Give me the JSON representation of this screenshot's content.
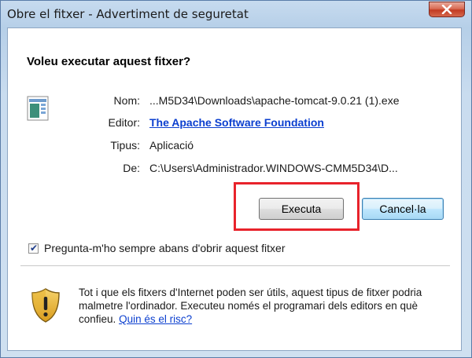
{
  "window": {
    "title": "Obre el fitxer - Advertiment de seguretat"
  },
  "dialog": {
    "heading": "Voleu executar aquest fitxer?",
    "fields": [
      {
        "label": "Nom:",
        "value": "...M5D34\\Downloads\\apache-tomcat-9.0.21 (1).exe"
      },
      {
        "label": "Editor:",
        "value": "The Apache Software Foundation"
      },
      {
        "label": "Tipus:",
        "value": "Aplicació"
      },
      {
        "label": "De:",
        "value": "C:\\Users\\Administrador.WINDOWS-CMM5D34\\D..."
      }
    ],
    "buttons": {
      "run": "Executa",
      "cancel": "Cancel·la"
    },
    "checkbox": {
      "label": "Pregunta-m'ho sempre abans d'obrir aquest fitxer",
      "checked": true
    },
    "warning": {
      "text": "Tot i que els fitxers d'Internet poden ser útils, aquest tipus de fitxer podria malmetre l'ordinador. Executeu només el programari dels editors en què confieu.",
      "link": "Quin és el risc?"
    }
  },
  "colors": {
    "link": "#0b3fcf",
    "highlight_border": "#e8232b",
    "close_button": "#c23b22"
  },
  "icons": {
    "close": "close-icon",
    "file": "application-file-icon",
    "warning": "security-shield-icon"
  }
}
